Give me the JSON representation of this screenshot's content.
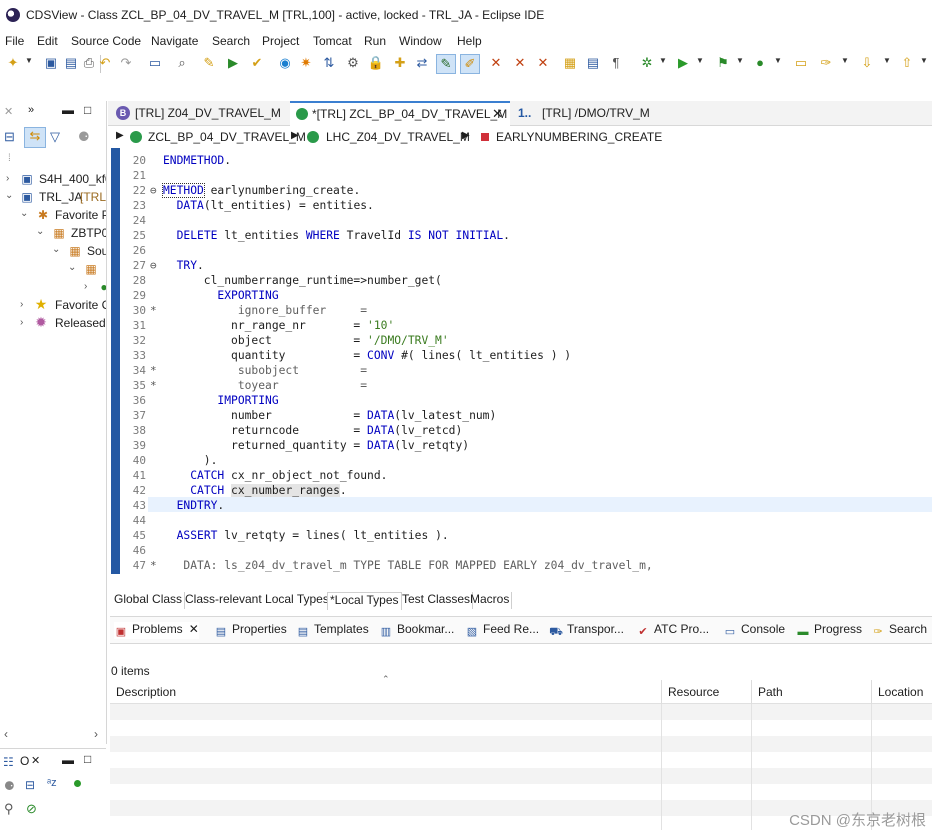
{
  "window": {
    "title": "CDSView - Class ZCL_BP_04_DV_TRAVEL_M [TRL,100] - active, locked - TRL_JA - Eclipse IDE"
  },
  "menu": [
    "File",
    "Edit",
    "Source Code",
    "Navigate",
    "Search",
    "Project",
    "Tomcat",
    "Run",
    "Window",
    "Help"
  ],
  "project_explorer": {
    "items": [
      {
        "label": "S4H_400_kf0"
      },
      {
        "label": "TRL_JA",
        "suffix": "[TRL"
      },
      {
        "label": "Favorite P"
      },
      {
        "label": "ZBTP0"
      },
      {
        "label": "Sou"
      },
      {
        "label": ""
      },
      {
        "label": ""
      },
      {
        "label": "Favorite C"
      },
      {
        "label": "Released"
      }
    ]
  },
  "editor_tabs": [
    {
      "label": "[TRL] Z04_DV_TRAVEL_M",
      "icon": "behavior-definition-icon",
      "active": false
    },
    {
      "label": "*[TRL] ZCL_BP_04_DV_TRAVEL_M",
      "icon": "class-icon",
      "active": true
    },
    {
      "label": "[TRL] /DMO/TRV_M",
      "icon": "numberrange-icon",
      "prefix": "1..",
      "active": false
    }
  ],
  "breadcrumb": [
    "ZCL_BP_04_DV_TRAVEL_M",
    "LHC_Z04_DV_TRAVEL_M",
    "EARLYNUMBERING_CREATE"
  ],
  "code_lines": [
    {
      "n": "20",
      "mark": "",
      "text": "ENDMETHOD."
    },
    {
      "n": "21",
      "mark": "",
      "text": ""
    },
    {
      "n": "22",
      "mark": "⊖",
      "text": "METHOD earlynumbering_create."
    },
    {
      "n": "23",
      "mark": "",
      "text": "  DATA(lt_entities) = entities."
    },
    {
      "n": "24",
      "mark": "",
      "text": ""
    },
    {
      "n": "25",
      "mark": "",
      "text": "  DELETE lt_entities WHERE TravelId IS NOT INITIAL."
    },
    {
      "n": "26",
      "mark": "",
      "text": ""
    },
    {
      "n": "27",
      "mark": "⊖",
      "text": "  TRY."
    },
    {
      "n": "28",
      "mark": "",
      "text": "      cl_numberrange_runtime=>number_get("
    },
    {
      "n": "29",
      "mark": "",
      "text": "        EXPORTING"
    },
    {
      "n": "30",
      "mark": "*",
      "text": "           ignore_buffer     ="
    },
    {
      "n": "31",
      "mark": "",
      "text": "          nr_range_nr       = '10'"
    },
    {
      "n": "32",
      "mark": "",
      "text": "          object            = '/DMO/TRV_M'"
    },
    {
      "n": "33",
      "mark": "",
      "text": "          quantity          = CONV #( lines( lt_entities ) )"
    },
    {
      "n": "34",
      "mark": "*",
      "text": "           subobject         ="
    },
    {
      "n": "35",
      "mark": "*",
      "text": "           toyear            ="
    },
    {
      "n": "36",
      "mark": "",
      "text": "        IMPORTING"
    },
    {
      "n": "37",
      "mark": "",
      "text": "          number            = DATA(lv_latest_num)"
    },
    {
      "n": "38",
      "mark": "",
      "text": "          returncode        = DATA(lv_retcd)"
    },
    {
      "n": "39",
      "mark": "",
      "text": "          returned_quantity = DATA(lv_retqty)"
    },
    {
      "n": "40",
      "mark": "",
      "text": "      )."
    },
    {
      "n": "41",
      "mark": "",
      "text": "    CATCH cx_nr_object_not_found."
    },
    {
      "n": "42",
      "mark": "",
      "text": "    CATCH cx_number_ranges."
    },
    {
      "n": "43",
      "mark": "",
      "text": "  ENDTRY."
    },
    {
      "n": "44",
      "mark": "",
      "text": ""
    },
    {
      "n": "45",
      "mark": "",
      "text": "  ASSERT lv_retqty = lines( lt_entities )."
    },
    {
      "n": "46",
      "mark": "",
      "text": ""
    },
    {
      "n": "47",
      "mark": "*",
      "text": "   DATA: ls_z04_dv_travel_m TYPE TABLE FOR MAPPED EARLY z04_dv_travel_m,"
    }
  ],
  "source_tabs": [
    "Global Class",
    "Class-relevant Local Types",
    "*Local Types",
    "Test Classes",
    "Macros"
  ],
  "view_tabs": [
    "Problems",
    "Properties",
    "Templates",
    "Bookmar...",
    "Feed Re...",
    "Transpor...",
    "ATC Pro...",
    "Console",
    "Progress",
    "Search"
  ],
  "problems": {
    "count_text": "0 items",
    "columns": [
      "Description",
      "Resource",
      "Path",
      "Location"
    ]
  },
  "outline": {
    "tab_label": "O"
  },
  "watermark": "CSDN @东京老树根",
  "colors": {
    "keyword": "#0000c0",
    "string": "#3a7b1f",
    "comment": "#5f5f5f",
    "ruler": "#2458a3",
    "active_tab": "#3b7fd0"
  }
}
